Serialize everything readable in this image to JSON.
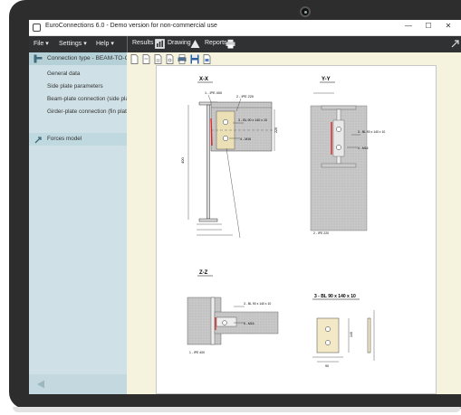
{
  "window": {
    "title": "EuroConnections 6.0 - Demo version for non-commercial use",
    "controls": {
      "minimize": "—",
      "maximize": "☐",
      "close": "✕"
    }
  },
  "menubar": {
    "file": "File",
    "settings": "Settings",
    "help": "Help",
    "results": "Results",
    "drawing": "Drawing",
    "reports": "Reports"
  },
  "sidebar": {
    "header": "Connection type - BEAM-TO-GIRD",
    "items": [
      {
        "label": "General data"
      },
      {
        "label": "Side plate parameters"
      },
      {
        "label": "Beam-plate connection (side plate)"
      },
      {
        "label": "Girder-plate connection (fin plate)"
      }
    ],
    "forces": "Forces model"
  },
  "drawing": {
    "views": {
      "xx": "X-X",
      "yy": "Y-Y",
      "zz": "Z-Z"
    },
    "plate_title": "3 - BL 90 x 140 x 10",
    "labels": {
      "ipe400_top": "1 - IPE 400",
      "ipe220": "2 - IPE 220",
      "bl_main": "3 - BL 90 x 140 x 10",
      "m16": "4 - M16",
      "bl_yy": "3 - BL 90 x 140 x 10",
      "m16_yy": "4 - M16",
      "ipe220_bottom": "2 - IPE 220",
      "ipe400_mid": "1 - IPE 400",
      "bl_zz": "3 - BL 90 x 140 x 10",
      "m16_zz": "4 - M16",
      "ipe400_zz": "1 - IPE 400"
    },
    "dims": {
      "h1": "400",
      "h2": "220",
      "w1": "90",
      "w2": "140"
    }
  }
}
